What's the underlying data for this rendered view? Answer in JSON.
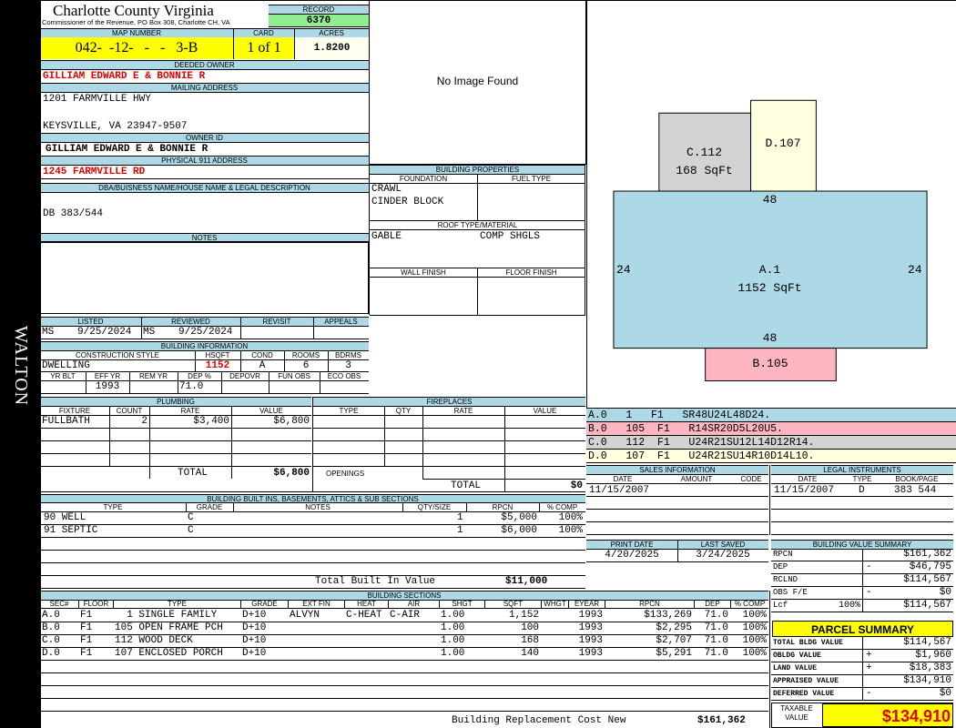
{
  "side_label": "WALTON",
  "header": {
    "county": "Charlotte County Virginia",
    "office": "Commissioner of the Revenue, PO Box 308, Charlotte CH, VA",
    "record_label": "RECORD",
    "record": "6370",
    "map_label": "MAP NUMBER",
    "map_number": "042-  -12-   -   -   3-B",
    "card_label": "CARD",
    "card": "1 of 1",
    "acres_label": "ACRES",
    "acres": "1.8200"
  },
  "owner": {
    "deeded_label": "DEEDED OWNER",
    "deeded": "GILLIAM EDWARD E & BONNIE R",
    "mailing_label": "MAILING ADDRESS",
    "addr1": "1201 FARMVILLE HWY",
    "addr2": "KEYSVILLE, VA 23947-9507",
    "owner_id_label": "OWNER ID",
    "owner_id": "GILLIAM EDWARD E & BONNIE R",
    "physical_label": "PHYSICAL 911 ADDRESS",
    "physical": "1245 FARMVILLE RD",
    "dba_label": "DBA/BUISNESS NAME/HOUSE NAME & LEGAL DESCRIPTION",
    "dba": "DB 383/544",
    "notes_label": "NOTES"
  },
  "image": {
    "text": "No Image Found"
  },
  "building_props": {
    "label": "BUILDING PROPERTIES",
    "foundation_label": "FOUNDATION",
    "fuel_label": "FUEL TYPE",
    "foundation1": "CRAWL",
    "foundation2": "CINDER BLOCK",
    "roof_label": "ROOF TYPE/MATERIAL",
    "roof_type": "GABLE",
    "roof_mat": "COMP SHGLS",
    "wall_label": "WALL FINISH",
    "floor_label": "FLOOR FINISH"
  },
  "status": {
    "listed_label": "LISTED",
    "listed_by": "MS",
    "listed": "9/25/2024",
    "reviewed_label": "REVIEWED",
    "reviewed_by": "MS",
    "reviewed": "9/25/2024",
    "revisit_label": "REVISIT",
    "appeals_label": "APPEALS"
  },
  "building_info": {
    "label": "BUILDING INFORMATION",
    "cs_label": "CONSTRUCTION STYLE",
    "hsqft_label": "HSQFT",
    "cond_label": "COND",
    "rooms_label": "ROOMS",
    "bdrms_label": "BDRMS",
    "style": "DWELLING",
    "hsqft": "1152",
    "cond": "A",
    "rooms": "6",
    "bdrms": "3",
    "yrblt_label": "YR BLT",
    "effyr_label": "EFF YR",
    "remyr_label": "REM YR",
    "dep_label": "DEP %",
    "depovr_label": "DEPOVR",
    "funobs_label": "FUN OBS",
    "ecoobs_label": "ECO OBS",
    "effyr": "1993",
    "dep": "71.0"
  },
  "plumbing": {
    "label": "PLUMBING",
    "cols": [
      "FIXTURE",
      "COUNT",
      "RATE",
      "VALUE"
    ],
    "rows": [
      {
        "fixture": "FULLBATH",
        "count": "2",
        "rate": "$3,400",
        "value": "$6,800"
      }
    ],
    "total_label": "TOTAL",
    "total": "$6,800"
  },
  "fireplaces": {
    "label": "FIREPLACES",
    "cols": [
      "TYPE",
      "QTY",
      "RATE",
      "VALUE"
    ],
    "openings_label": "OPENINGS",
    "total_label": "TOTAL",
    "total": "$0"
  },
  "builtins": {
    "label": "BUILDING BUILT INS, BASEMENTS, ATTICS & SUB SECTIONS",
    "cols": [
      "TYPE",
      "GRADE",
      "NOTES",
      "QTY/SIZE",
      "RPCN",
      "% COMP"
    ],
    "rows": [
      {
        "type": "90 WELL",
        "grade": "C",
        "qty": "1",
        "rpcn": "$5,000",
        "comp": "100%"
      },
      {
        "type": "91 SEPTIC",
        "grade": "C",
        "qty": "1",
        "rpcn": "$6,000",
        "comp": "100%"
      }
    ],
    "total_label": "Total Built In Value",
    "total": "$11,000"
  },
  "sections": {
    "label": "BUILDING SECTIONS",
    "cols": [
      "SEC#",
      "FLOOR",
      "TYPE",
      "GRADE",
      "EXT FIN",
      "HEAT",
      "AIR",
      "SHGT",
      "SQFT",
      "WHGT",
      "EYEAR",
      "RPCN",
      "DEP",
      "% COMP"
    ],
    "rows": [
      {
        "sec": "A.0",
        "floor": "F1",
        "type": "  1 SINGLE FAMILY",
        "grade": "D+10",
        "ext": "ALVYN",
        "heat": "C-HEAT",
        "air": "C-AIR",
        "shgt": "1.00",
        "sqft": "1,152",
        "eyear": "1993",
        "rpcn": "$133,269",
        "dep": "71.0",
        "comp": "100%"
      },
      {
        "sec": "B.0",
        "floor": "F1",
        "type": "105 OPEN FRAME PCH",
        "grade": "D+10",
        "ext": "",
        "heat": "",
        "air": "",
        "shgt": "1.00",
        "sqft": "100",
        "eyear": "1993",
        "rpcn": "$2,295",
        "dep": "71.0",
        "comp": "100%"
      },
      {
        "sec": "C.0",
        "floor": "F1",
        "type": "112 WOOD DECK",
        "grade": "D+10",
        "ext": "",
        "heat": "",
        "air": "",
        "shgt": "1.00",
        "sqft": "168",
        "eyear": "1993",
        "rpcn": "$2,707",
        "dep": "71.0",
        "comp": "100%"
      },
      {
        "sec": "D.0",
        "floor": "F1",
        "type": "107 ENCLOSED PORCH",
        "grade": "D+10",
        "ext": "",
        "heat": "",
        "air": "",
        "shgt": "1.00",
        "sqft": "140",
        "eyear": "1993",
        "rpcn": "$5,291",
        "dep": "71.0",
        "comp": "100%"
      }
    ],
    "total_label": "Building Replacement Cost New",
    "total": "$161,362"
  },
  "sketch": {
    "c_label": "C.112",
    "c_area": "168 SqFt",
    "d_label": "D.107",
    "a_label": "A.1",
    "a_area": "1152 SqFt",
    "b_label": "B.105",
    "top": "48",
    "bottom": "48",
    "left": "24",
    "right": "24",
    "colors": {
      "a": "#add8e6",
      "b": "#ffb6c1",
      "c": "#d3d3d3",
      "d": "#ffffe0"
    }
  },
  "sketch_codes": [
    {
      "text": "A.0   1   F1   SR48U24L48D24.",
      "color": "#add8e6"
    },
    {
      "text": "B.0   105  F1   R14SR20D5L20U5.",
      "color": "#ffb6c1"
    },
    {
      "text": "C.0   112  F1   U24R21SU12L14D12R14.",
      "color": "#d3d3d3"
    },
    {
      "text": "D.0   107  F1   U24R21SU14R10D14L10.",
      "color": "#ffffe0"
    }
  ],
  "sales": {
    "label": "SALES INFORMATION",
    "cols": [
      "DATE",
      "AMOUNT",
      "CODE"
    ],
    "date": "11/15/2007"
  },
  "legal": {
    "label": "LEGAL INSTRUMENTS",
    "cols": [
      "DATE",
      "TYPE",
      "BOOK/PAGE"
    ],
    "date": "11/15/2007",
    "type": "D",
    "book": "383 544"
  },
  "print": {
    "print_label": "PRINT DATE",
    "print": "4/20/2025",
    "saved_label": "LAST SAVED",
    "saved": "3/24/2025"
  },
  "value_summary": {
    "label": "BUILDING VALUE SUMMARY",
    "rows": [
      {
        "k": "RPCN",
        "s": "",
        "v": "$161,362"
      },
      {
        "k": "DEP",
        "s": "-",
        "v": "$46,795"
      },
      {
        "k": "RCLND",
        "s": "",
        "v": "$114,567"
      },
      {
        "k": "OBS F/E",
        "s": "-",
        "v": "$0"
      },
      {
        "k": "Lcf",
        "p": "100%",
        "s": "",
        "v": "$114,567"
      }
    ]
  },
  "parcel": {
    "label": "PARCEL SUMMARY",
    "rows": [
      {
        "k": "TOTAL BLDG VALUE",
        "s": "",
        "v": "$114,567"
      },
      {
        "k": "OBLDG VALUE",
        "s": "+",
        "v": "$1,960"
      },
      {
        "k": "LAND VALUE",
        "s": "+",
        "v": "$18,383"
      },
      {
        "k": "APPRAISED VALUE",
        "s": "",
        "v": "$134,910"
      },
      {
        "k": "DEFERRED VALUE",
        "s": "-",
        "v": "$0"
      }
    ],
    "taxable_label": "TAXABLE VALUE",
    "taxable": "$134,910"
  }
}
